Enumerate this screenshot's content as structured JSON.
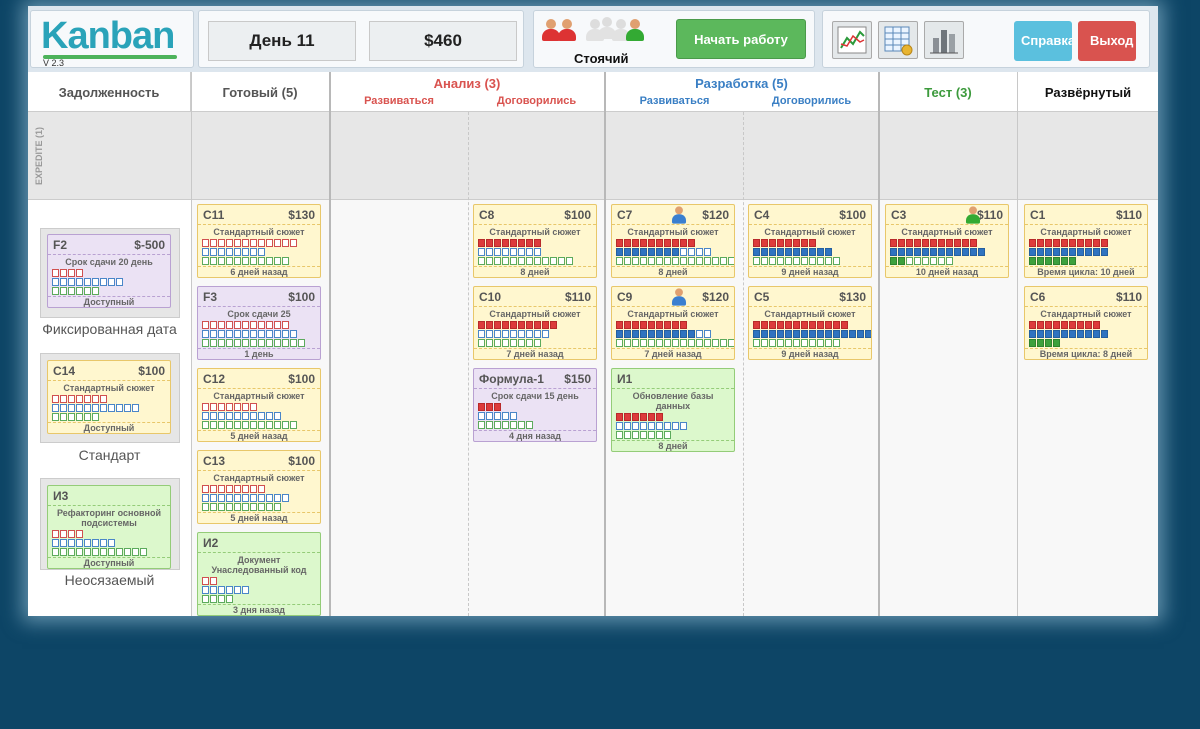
{
  "app": {
    "logo": "Kanban",
    "version": "V 2.3",
    "day": "День 11",
    "money": "$460",
    "team_status": "Стоячий",
    "start_label": "Начать работу",
    "help_label": "Справка",
    "exit_label": "Выход",
    "tools": [
      "chart-icon",
      "spreadsheet-icon",
      "bar-chart-icon"
    ]
  },
  "colors": {
    "analysis": "#d9534f",
    "development": "#3a7fc4",
    "test": "#3c9a3c",
    "story_card": "#fff7cf",
    "fixed_card": "#ebe2f4",
    "intangible_card": "#dcf8cc"
  },
  "columns": {
    "backlog": "Задолженность",
    "ready": "Готовый (5)",
    "analysis": "Анализ (3)",
    "analysis_doing": "Развиваться",
    "analysis_done": "Договорились",
    "development": "Разработка (5)",
    "dev_doing": "Развиваться",
    "dev_done": "Договорились",
    "test": "Тест (3)",
    "deployed": "Развёрнутый"
  },
  "expedite_label": "EXPEDITE (1)",
  "backlog": {
    "fixed": {
      "caption": "Фиксированная дата",
      "card": {
        "id": "F2",
        "value": "$-500",
        "title": "Срок сдачи 20 день",
        "bars": [
          [
            0,
            4
          ],
          [
            0,
            9
          ],
          [
            0,
            6
          ]
        ],
        "foot": "Доступный"
      }
    },
    "standard": {
      "caption": "Стандарт",
      "card": {
        "id": "C14",
        "value": "$100",
        "title": "Стандартный сюжет",
        "bars": [
          [
            0,
            7
          ],
          [
            0,
            11
          ],
          [
            0,
            6
          ]
        ],
        "foot": "Доступный"
      }
    },
    "intangible": {
      "caption": "Неосязаемый",
      "card": {
        "id": "И3",
        "value": "",
        "title": "Рефакторинг основной подсистемы",
        "bars": [
          [
            0,
            4
          ],
          [
            0,
            8
          ],
          [
            0,
            12
          ]
        ],
        "foot": "Доступный"
      }
    }
  },
  "ready": [
    {
      "id": "C11",
      "value": "$130",
      "title": "Стандартный сюжет",
      "bars": [
        [
          0,
          12
        ],
        [
          0,
          8
        ],
        [
          0,
          11
        ]
      ],
      "foot": "6 дней назад"
    },
    {
      "id": "F3",
      "value": "$100",
      "title": "Срок сдачи 25",
      "bars": [
        [
          0,
          11
        ],
        [
          0,
          12
        ],
        [
          0,
          13
        ]
      ],
      "foot": "1 день"
    },
    {
      "id": "C12",
      "value": "$100",
      "title": "Стандартный сюжет",
      "bars": [
        [
          0,
          7
        ],
        [
          0,
          10
        ],
        [
          0,
          12
        ]
      ],
      "foot": "5 дней назад"
    },
    {
      "id": "C13",
      "value": "$100",
      "title": "Стандартный сюжет",
      "bars": [
        [
          0,
          8
        ],
        [
          0,
          11
        ],
        [
          0,
          10
        ]
      ],
      "foot": "5 дней назад"
    },
    {
      "id": "И2",
      "value": "",
      "title": "Документ Унаследованный код",
      "bars": [
        [
          0,
          2
        ],
        [
          0,
          6
        ],
        [
          0,
          4
        ]
      ],
      "foot": "3 дня назад"
    }
  ],
  "analysis_done": [
    {
      "id": "C8",
      "value": "$100",
      "title": "Стандартный сюжет",
      "bars": [
        [
          8,
          8
        ],
        [
          0,
          8
        ],
        [
          0,
          12
        ]
      ],
      "foot": "8 дней"
    },
    {
      "id": "C10",
      "value": "$110",
      "title": "Стандартный сюжет",
      "bars": [
        [
          10,
          10
        ],
        [
          0,
          9
        ],
        [
          0,
          8
        ]
      ],
      "foot": "7 дней назад"
    },
    {
      "id": "Формула-1",
      "value": "$150",
      "title": "Срок сдачи 15 день",
      "bars": [
        [
          3,
          3
        ],
        [
          0,
          5
        ],
        [
          0,
          7
        ]
      ],
      "foot": "4 дня назад"
    }
  ],
  "dev_doing": [
    {
      "id": "C7",
      "value": "$120",
      "title": "Стандартный сюжет",
      "worker": true,
      "bars": [
        [
          10,
          10
        ],
        [
          8,
          12
        ],
        [
          0,
          15
        ]
      ],
      "foot": "8 дней"
    },
    {
      "id": "C9",
      "value": "$120",
      "title": "Стандартный сюжет",
      "worker": true,
      "bars": [
        [
          9,
          9
        ],
        [
          10,
          12
        ],
        [
          0,
          15
        ]
      ],
      "foot": "7 дней назад"
    },
    {
      "id": "И1",
      "value": "",
      "title": "Обновление базы данных",
      "bars": [
        [
          6,
          6
        ],
        [
          0,
          9
        ],
        [
          0,
          7
        ]
      ],
      "foot": "8 дней"
    }
  ],
  "dev_done": [
    {
      "id": "C4",
      "value": "$100",
      "title": "Стандартный сюжет",
      "bars": [
        [
          8,
          8
        ],
        [
          10,
          10
        ],
        [
          0,
          11
        ]
      ],
      "foot": "9 дней назад"
    },
    {
      "id": "C5",
      "value": "$130",
      "title": "Стандартный сюжет",
      "bars": [
        [
          12,
          12
        ],
        [
          15,
          15
        ],
        [
          0,
          11
        ]
      ],
      "foot": "9 дней назад"
    }
  ],
  "test": [
    {
      "id": "C3",
      "value": "$110",
      "title": "Стандартный сюжет",
      "worker": true,
      "bars": [
        [
          11,
          11
        ],
        [
          12,
          12
        ],
        [
          2,
          8
        ]
      ],
      "foot": "10 дней назад"
    }
  ],
  "deployed": [
    {
      "id": "C1",
      "value": "$110",
      "title": "Стандартный сюжет",
      "bars": [
        [
          10,
          10
        ],
        [
          10,
          10
        ],
        [
          6,
          6
        ]
      ],
      "foot": "Время цикла: 10 дней"
    },
    {
      "id": "C6",
      "value": "$110",
      "title": "Стандартный сюжет",
      "bars": [
        [
          9,
          9
        ],
        [
          10,
          10
        ],
        [
          4,
          4
        ]
      ],
      "foot": "Время цикла: 8 дней"
    }
  ]
}
